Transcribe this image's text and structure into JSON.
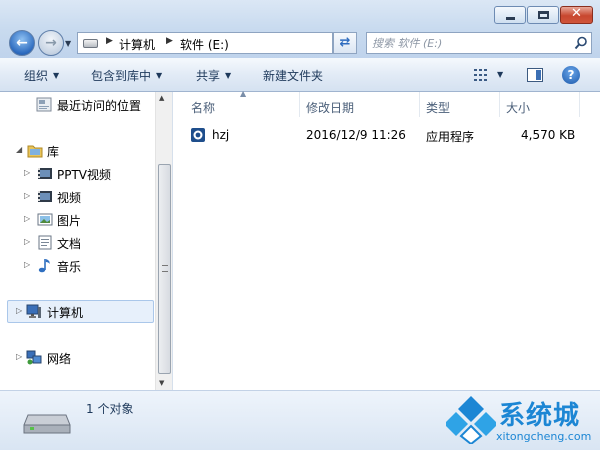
{
  "window": {
    "controls": {
      "min_icon": "minimize-icon",
      "max_icon": "maximize-icon",
      "close_icon": "close-icon",
      "close_glyph": "✕"
    }
  },
  "address": {
    "crumbs": [
      "计算机",
      "软件 (E:)"
    ],
    "refresh_glyph": "⇄"
  },
  "search": {
    "placeholder": "搜索 软件 (E:)"
  },
  "toolbar": {
    "organize": "组织",
    "include_in_library": "包含到库中",
    "share": "共享",
    "new_folder": "新建文件夹",
    "help_glyph": "?"
  },
  "nav": {
    "recent": "最近访问的位置",
    "library": "库",
    "library_items": [
      "PPTV视频",
      "视频",
      "图片",
      "文档",
      "音乐"
    ],
    "computer": "计算机",
    "network": "网络"
  },
  "columns": {
    "name": "名称",
    "date": "修改日期",
    "type": "类型",
    "size": "大小"
  },
  "files": [
    {
      "name": "hzj",
      "date": "2016/12/9 11:26",
      "type": "应用程序",
      "size": "4,570 KB"
    }
  ],
  "status": {
    "text": "1 个对象"
  },
  "watermark": {
    "name": "系统城",
    "url": "xitongcheng.com"
  },
  "colors": {
    "accent": "#1c86d4",
    "selection": "#e7f0fb",
    "close": "#c8472f"
  }
}
